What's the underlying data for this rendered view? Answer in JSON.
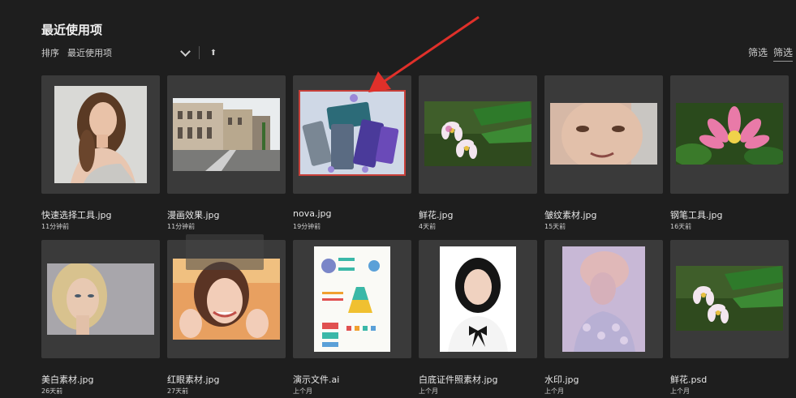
{
  "header": {
    "title": "最近使用项"
  },
  "sort": {
    "label": "排序",
    "value": "最近使用项"
  },
  "filters": {
    "filter_label": "筛选",
    "filter_label_2": "筛选"
  },
  "colors": {
    "background": "#1e1e1e",
    "tile": "#3a3a3a",
    "selected": "#c8403a",
    "annotation_arrow": "#e0302a"
  },
  "files": [
    {
      "name": "快速选择工具.jpg",
      "time": "11分钟前",
      "icon": "portrait-woman-curly-thumbnail"
    },
    {
      "name": "漫画效果.jpg",
      "time": "11分钟前",
      "icon": "street-buildings-thumbnail"
    },
    {
      "name": "nova.jpg",
      "time": "19分钟前",
      "icon": "phones-thumbnail",
      "selected": true
    },
    {
      "name": "鲜花.jpg",
      "time": "4天前",
      "icon": "flowers-thumbnail"
    },
    {
      "name": "皱纹素材.jpg",
      "time": "15天前",
      "icon": "older-face-thumbnail"
    },
    {
      "name": "钢笔工具.jpg",
      "time": "16天前",
      "icon": "pink-lotus-thumbnail"
    },
    {
      "name": "美白素材.jpg",
      "time": "26天前",
      "icon": "blonde-woman-thumbnail"
    },
    {
      "name": "红眼素材.jpg",
      "time": "27天前",
      "icon": "smiling-woman-thumbnail"
    },
    {
      "name": "演示文件.ai",
      "time": "上个月",
      "icon": "infographic-thumbnail"
    },
    {
      "name": "白底证件照素材.jpg",
      "time": "上个月",
      "icon": "id-photo-thumbnail"
    },
    {
      "name": "水印.jpg",
      "time": "上个月",
      "icon": "pastel-portrait-thumbnail"
    },
    {
      "name": "鲜花.psd",
      "time": "上个月",
      "icon": "flowers-thumbnail"
    }
  ]
}
